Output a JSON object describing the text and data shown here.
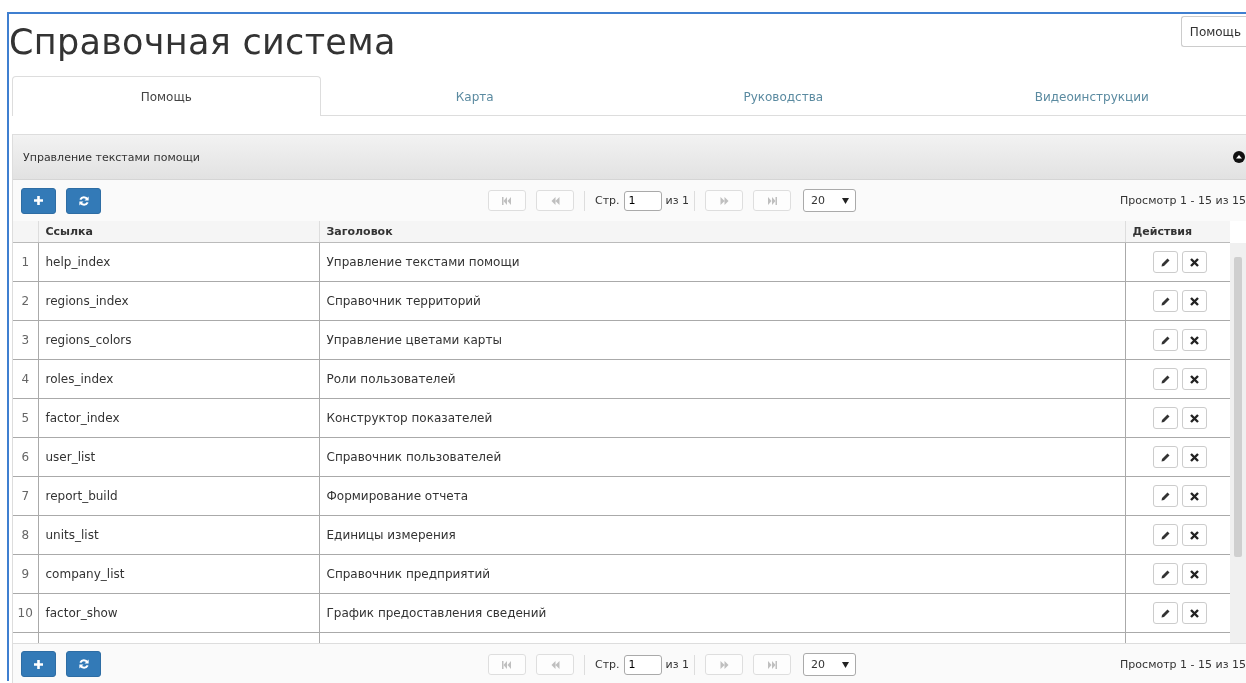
{
  "title": "Справочная система",
  "help_button": "Помощь",
  "tabs": [
    {
      "label": "Помощь",
      "selected": true
    },
    {
      "label": "Карта",
      "selected": false
    },
    {
      "label": "Руководства",
      "selected": false
    },
    {
      "label": "Видеоинструкции",
      "selected": false
    }
  ],
  "panel": {
    "title": "Управление текстами помощи",
    "expanded": true
  },
  "toolbars": [
    {
      "page_label": "Стр.",
      "page": "1",
      "of_label": "из 1",
      "page_size": "20",
      "info": "Просмотр 1 - 15 из 15",
      "nav_disabled": true
    },
    {
      "page_label": "Стр.",
      "page": "1",
      "of_label": "из 1",
      "page_size": "20",
      "info": "Просмотр 1 - 15 из 15",
      "nav_disabled": true
    }
  ],
  "table": {
    "columns": [
      "Ссылка",
      "Заголовок",
      "Действия"
    ],
    "rows": [
      {
        "num": "1",
        "link": "help_index",
        "title": "Управление текстами помощи"
      },
      {
        "num": "2",
        "link": "regions_index",
        "title": "Справочник территорий"
      },
      {
        "num": "3",
        "link": "regions_colors",
        "title": "Управление цветами карты"
      },
      {
        "num": "4",
        "link": "roles_index",
        "title": "Роли пользователей"
      },
      {
        "num": "5",
        "link": "factor_index",
        "title": "Конструктор показателей"
      },
      {
        "num": "6",
        "link": "user_list",
        "title": "Справочник пользователей"
      },
      {
        "num": "7",
        "link": "report_build",
        "title": "Формирование отчета"
      },
      {
        "num": "8",
        "link": "units_list",
        "title": "Единицы измерения"
      },
      {
        "num": "9",
        "link": "company_list",
        "title": "Справочник предприятий"
      },
      {
        "num": "10",
        "link": "factor_show",
        "title": "График предоставления сведений"
      }
    ]
  }
}
